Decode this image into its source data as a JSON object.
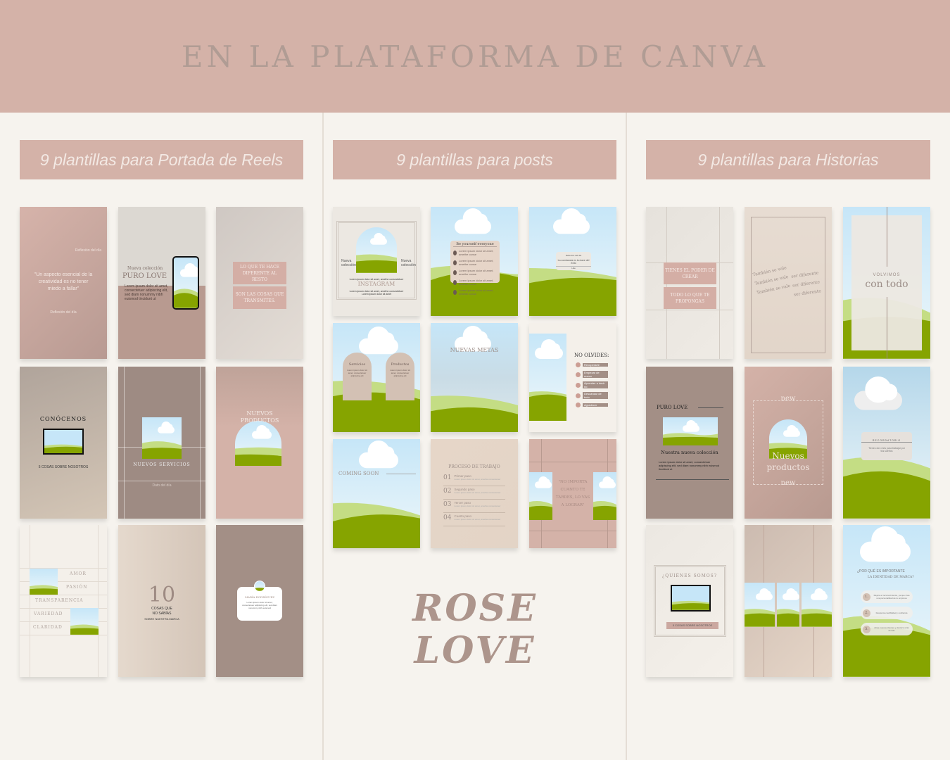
{
  "title": "EN LA PLATAFORMA DE CANVA",
  "colors": {
    "rose": "#d4b2a8",
    "taupe": "#a38f86",
    "cream": "#f6f3ee",
    "green": "#86a400",
    "sky": "#c6e6f8"
  },
  "columns": {
    "reels": "9 plantillas para Portada de Reels",
    "posts": "9 plantillas para posts",
    "historias": "9 plantillas para Historias"
  },
  "brand": {
    "line1": "ROSE",
    "line2": "LOVE"
  },
  "reels": {
    "r1": {
      "tag": "Reflexión del día",
      "quote": "\"Un aspecto esencial de la creatividad es no tener miedo a fallar\"",
      "foot": "Reflexión del día"
    },
    "r2": {
      "sub": "Nueva colección",
      "title": "PURO LOVE",
      "body": "Lorem ipsum dolor sit amet, consectetuer adipiscing elit, sed diam nonummy nibh euismod tincidunt ut"
    },
    "r3": {
      "box1": "LO QUE TE HACE DIFERENTE AL RESTO",
      "box2": "SON LAS COSAS QUE TRANSMITES."
    },
    "r4": {
      "title": "CONÓCENOS",
      "sub": "5 COSAS SOBRE NOSOTROS"
    },
    "r5": {
      "title": "NUEVOS SERVICIOS",
      "sub": "Dato del día"
    },
    "r6": {
      "title": "NUEVOS PRODUCTOS"
    },
    "r7": {
      "words": [
        "AMOR",
        "PASIÓN",
        "TRANSPARENCIA",
        "VARIEDAD",
        "CLARIDAD"
      ]
    },
    "r8": {
      "num": "10",
      "l1": "COSAS QUE",
      "l2": "NO SABÍAS",
      "l3": "SOBRE NUESTRA MARCA"
    },
    "r9": {
      "name": "MARÍA RODRÍGUEZ",
      "body": "Lorem ipsum dolor sit amet, consectetuer adipiscing elit, sed diam nonummy nibh euismod"
    }
  },
  "posts": {
    "p1": {
      "left": "Nueva colección",
      "right": "Nueva colección",
      "top": "Lorem ipsum dolor sit amet, amethe consectetuer",
      "title": "INSTAGRAM",
      "body": "Lorem ipsum dolor sit amet, amethe consectetuer Lorem ipsum dolor sit amet"
    },
    "p2": {
      "title": "Be yourself everyone",
      "items": [
        "Lorem ipsum dolor sit amet, amethe conse",
        "Lorem ipsum dolor sit amet, amethe conse",
        "Lorem ipsum dolor sit amet, amethe conse",
        "Lorem ipsum dolor sit amet, amethe conse",
        "Lorem ipsum dolor sit amet, amethe conse"
      ]
    },
    "p3": {
      "head": "Reflexión del día",
      "body": "La constancia es la clave del éxito",
      "foot": "Like"
    },
    "p4": {
      "a": "Servicios",
      "b": "Productos",
      "body": "Lorem ipsum dolor sit amet, consectetuer adipiscing elit"
    },
    "p5": {
      "title": "NUEVAS METAS"
    },
    "p6": {
      "title": "NO OLVIDES:",
      "items": [
        "Recuperarte",
        "Empezar de nuevo",
        "Aprender a decir no",
        "Descansar de todo",
        "Agradecer"
      ]
    },
    "p7": {
      "title": "COMING SOON"
    },
    "p8": {
      "title": "PROCESO DE TRABAJO",
      "steps": [
        {
          "n": "01",
          "t": "Primer paso"
        },
        {
          "n": "02",
          "t": "Segundo paso"
        },
        {
          "n": "03",
          "t": "Tercer paso"
        },
        {
          "n": "04",
          "t": "Cuarto paso"
        }
      ],
      "lorem": "Lorem ipsum dolor sit amet, amethe consectetuer"
    },
    "p9": {
      "quote": "\"NO IMPORTA CUANTO TE TARDES, LO VAS A LOGRAR\""
    }
  },
  "historias": {
    "h1": {
      "box1": "TIENES EL PODER DE CREAR",
      "box2": "TODO LO QUE TE PROPONGAS"
    },
    "h2": {
      "a": "También se vale",
      "b": "ser diferente"
    },
    "h3": {
      "sub": "VOLVIMOS",
      "title": "con todo"
    },
    "h4": {
      "title": "PURO LOVE",
      "sub": "Nuestra nueva colección",
      "body": "Lorem ipsum dolor sit amet, consectetuer adipiscing elit, sed diam nonummy nibh euismod tincidunt ut"
    },
    "h5": {
      "new": "new",
      "title1": "Nuevos",
      "title2": "productos"
    },
    "h6": {
      "title": "RECORDATORIO",
      "body": "Tienes otro mes para trabajar por tus sueños"
    },
    "h7": {
      "title": "¿QUIÉNES SOMOS?",
      "btn": "5 COSAS SOBRE NOSOTROS"
    },
    "h9": {
      "q1": "¿POR QUÉ ES IMPORTANTE",
      "q2": "LA IDENTIDAD DE MARCA?",
      "items": [
        {
          "n": "1.",
          "t": "Mejora el reconocimiento, ya que crea una personalidad de tu empresa"
        },
        {
          "n": "2.",
          "t": "Despierta credibilidad y confianza"
        },
        {
          "n": "3.",
          "t": "Atrae nuevos clientes y destaca a las demás"
        }
      ]
    }
  }
}
